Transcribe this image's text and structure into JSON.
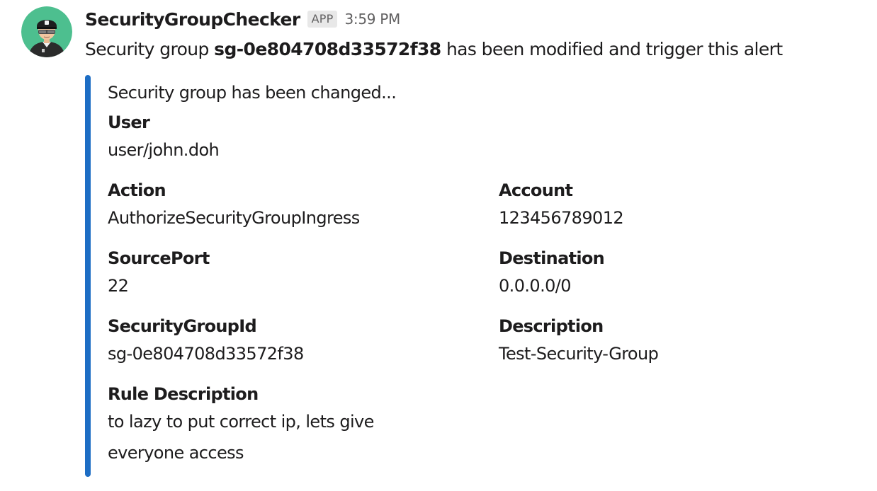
{
  "message": {
    "sender": "SecurityGroupChecker",
    "badge": "APP",
    "time": "3:59 PM",
    "text_prefix": "Security group ",
    "text_bold": "sg-0e804708d33572f38",
    "text_suffix": " has been modified and trigger this alert"
  },
  "attachment": {
    "accent_color": "#1d6dc4",
    "pretext": "Security group has been changed...",
    "fields": {
      "user": {
        "title": "User",
        "value": "user/john.doh"
      },
      "action": {
        "title": "Action",
        "value": "AuthorizeSecurityGroupIngress"
      },
      "account": {
        "title": "Account",
        "value": "123456789012"
      },
      "source_port": {
        "title": "SourcePort",
        "value": "22"
      },
      "destination": {
        "title": "Destination",
        "value": "0.0.0.0/0"
      },
      "security_group_id": {
        "title": "SecurityGroupId",
        "value": "sg-0e804708d33572f38"
      },
      "description": {
        "title": "Description",
        "value": "Test-Security-Group"
      },
      "rule_description": {
        "title": "Rule Description",
        "value": "to lazy to put correct ip, lets give everyone access"
      }
    }
  },
  "avatar": {
    "icon": "security-guard-avatar-icon",
    "background_color": "#4dbf8f"
  }
}
